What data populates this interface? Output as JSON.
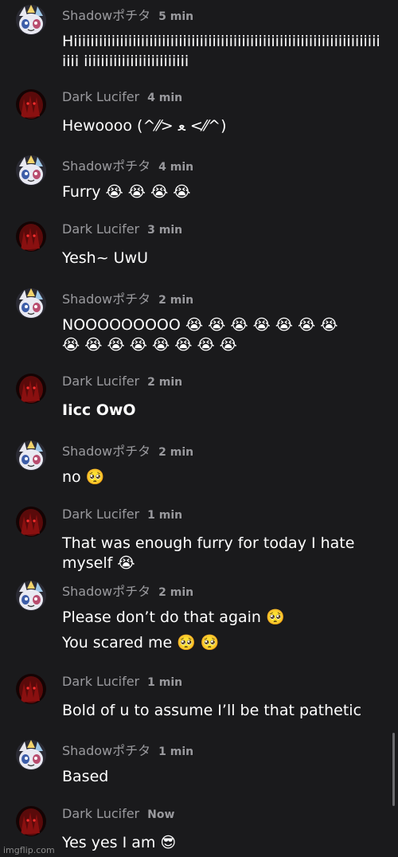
{
  "messages": [
    {
      "author": "Shadowポチタ",
      "time": "5 min",
      "avatar": "shadow",
      "lines": [
        "Hiiiiiiiiiiiiiiiiiiiiiiiiiiiiiiiiiiiiiiiiiiiiiiiiiiiiiiiiiiiiiiiiiiiiiiiiiiiii iiiiiiiiiiiiiiiiiiiiiiiii"
      ]
    },
    {
      "author": "Dark Lucifer",
      "time": "4 min",
      "avatar": "dark",
      "lines": [
        "Hewoooo (^⁄⁄> ﻌ <⁄⁄^)"
      ]
    },
    {
      "author": "Shadowポチタ",
      "time": "4 min",
      "avatar": "shadow",
      "lines": [
        "Furry 😭 😭 😭 😭"
      ]
    },
    {
      "author": "Dark Lucifer",
      "time": "3 min",
      "avatar": "dark",
      "lines": [
        "Yesh~ UwU"
      ]
    },
    {
      "author": "Shadowポチタ",
      "time": "2 min",
      "avatar": "shadow",
      "lines": [
        "NOOOOOOOOO 😭 😭 😭 😭 😭 😭 😭 😭 😭 😭 😭 😭 😭 😭 😭"
      ]
    },
    {
      "author": "Dark Lucifer",
      "time": "2 min",
      "avatar": "dark",
      "lines": [
        "Iicc OwO"
      ]
    },
    {
      "author": "Shadowポチタ",
      "time": "2 min",
      "avatar": "shadow",
      "lines": [
        "no 🥺"
      ]
    },
    {
      "author": "Dark Lucifer",
      "time": "1 min",
      "avatar": "dark",
      "lines": [
        "That was enough furry for today I hate myself 😭"
      ]
    },
    {
      "author": "Shadowポチタ",
      "time": "2 min",
      "avatar": "shadow",
      "lines": [
        "Please don’t do that again 🥺",
        "You scared me 🥺 🥺"
      ]
    },
    {
      "author": "Dark Lucifer",
      "time": "1 min",
      "avatar": "dark",
      "lines": [
        "Bold of u to assume I’ll be that pathetic"
      ]
    },
    {
      "author": "Shadowポチタ",
      "time": "1 min",
      "avatar": "shadow",
      "lines": [
        "Based"
      ]
    },
    {
      "author": "Dark Lucifer",
      "time": "Now",
      "avatar": "dark",
      "lines": [
        "Yes yes I am 😎"
      ]
    }
  ],
  "watermark": "imgflip.com"
}
